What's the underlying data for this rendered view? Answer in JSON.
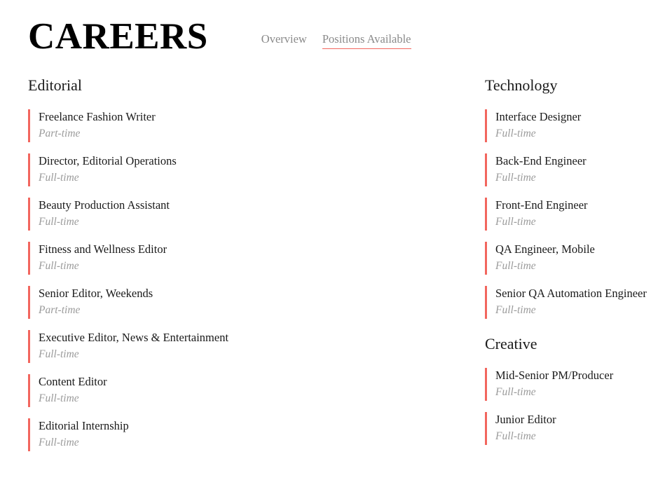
{
  "header": {
    "brand": "CAREERS",
    "nav": [
      {
        "label": "Overview",
        "active": false
      },
      {
        "label": "Positions Available",
        "active": true
      }
    ]
  },
  "theme": {
    "accent": "#f2665e",
    "text": "#1a1a1a",
    "muted": "#9b9b9b",
    "nav_text": "#8a8a8a",
    "background": "#ffffff"
  },
  "columns": {
    "left": [
      {
        "title": "Editorial",
        "jobs": [
          {
            "title": "Freelance Fashion Writer",
            "type": "Part-time"
          },
          {
            "title": "Director, Editorial Operations",
            "type": "Full-time"
          },
          {
            "title": "Beauty Production Assistant",
            "type": "Full-time"
          },
          {
            "title": "Fitness and Wellness Editor",
            "type": "Full-time"
          },
          {
            "title": "Senior Editor, Weekends",
            "type": "Part-time"
          },
          {
            "title": "Executive Editor, News & Entertainment",
            "type": "Full-time"
          },
          {
            "title": "Content Editor",
            "type": "Full-time"
          },
          {
            "title": "Editorial Internship",
            "type": "Full-time"
          }
        ]
      }
    ],
    "right": [
      {
        "title": "Technology",
        "jobs": [
          {
            "title": "Interface Designer",
            "type": "Full-time"
          },
          {
            "title": "Back-End Engineer",
            "type": "Full-time"
          },
          {
            "title": "Front-End Engineer",
            "type": "Full-time"
          },
          {
            "title": "QA Engineer, Mobile",
            "type": "Full-time"
          },
          {
            "title": "Senior QA Automation Engineer",
            "type": "Full-time"
          }
        ]
      },
      {
        "title": "Creative",
        "jobs": [
          {
            "title": "Mid-Senior PM/Producer",
            "type": "Full-time"
          },
          {
            "title": "Junior Editor",
            "type": "Full-time"
          }
        ]
      }
    ]
  }
}
